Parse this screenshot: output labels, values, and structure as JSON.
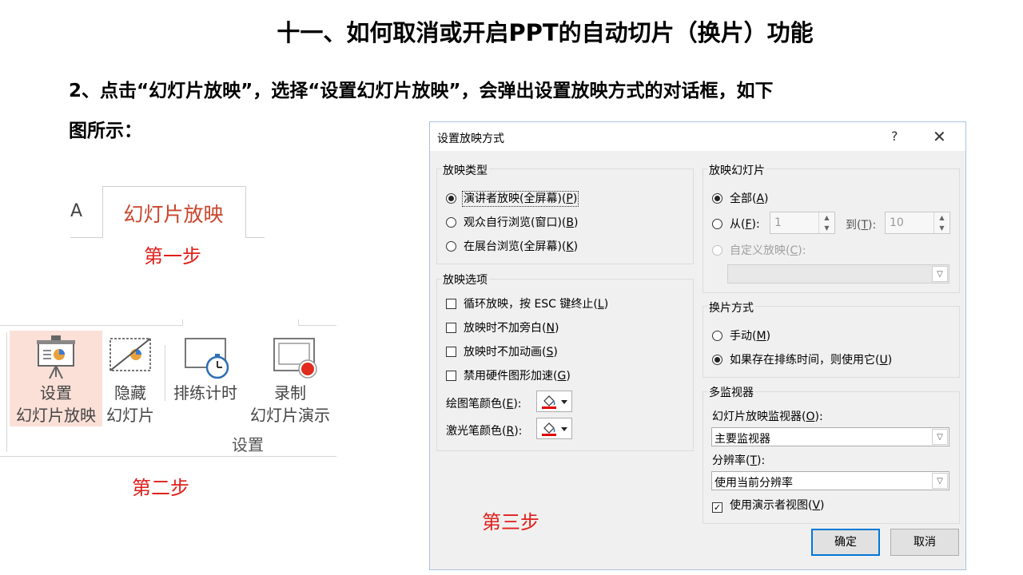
{
  "slide": {
    "title": "十一、如何取消或开启PPT的自动切片（换片）功能",
    "paragraph_line1": "2、点击“幻灯片放映”，选择“设置幻灯片放映”，会弹出设置放映方式的对话框，如下",
    "paragraph_line2": "图所示：",
    "step1": "第一步",
    "step2": "第二步",
    "step3": "第三步"
  },
  "ribbon": {
    "prev_tab_fragment": "A",
    "active_tab": "幻灯片放映",
    "buttons": [
      {
        "line1": "设置",
        "line2": "幻灯片放映"
      },
      {
        "line1": "隐藏",
        "line2": "幻灯片"
      },
      {
        "line1": "排练计时",
        "line2": ""
      },
      {
        "line1": "录制",
        "line2": "幻灯片演示"
      }
    ],
    "group_label": "设置"
  },
  "dialog": {
    "title": "设置放映方式",
    "help": "?",
    "close": "✕",
    "show_type": {
      "label": "放映类型",
      "options": [
        {
          "text": "演讲者放映(全屏幕)(",
          "key": "P",
          "selected": true
        },
        {
          "text": "观众自行浏览(窗口)(",
          "key": "B",
          "selected": false
        },
        {
          "text": "在展台浏览(全屏幕)(",
          "key": "K",
          "selected": false
        }
      ]
    },
    "show_options": {
      "label": "放映选项",
      "checks": [
        {
          "text": "循环放映，按 ESC 键终止(",
          "key": "L",
          "checked": false
        },
        {
          "text": "放映时不加旁白(",
          "key": "N",
          "checked": false
        },
        {
          "text": "放映时不加动画(",
          "key": "S",
          "checked": false
        },
        {
          "text": "禁用硬件图形加速(",
          "key": "G",
          "checked": false
        }
      ],
      "pen_color_label": "绘图笔颜色(",
      "pen_color_key": "E",
      "laser_color_label": "激光笔颜色(",
      "laser_color_key": "R",
      "pen_color": "#e00000",
      "laser_color": "#e00000"
    },
    "show_slides": {
      "label": "放映幻灯片",
      "all_text": "全部(",
      "all_key": "A",
      "from_text": "从(",
      "from_key": "F",
      "from_value": "1",
      "to_text": "到(",
      "to_key": "T",
      "to_value": "10",
      "custom_text": "自定义放映(",
      "custom_key": "C",
      "selected": "all"
    },
    "advance": {
      "label": "换片方式",
      "manual_text": "手动(",
      "manual_key": "M",
      "timings_text": "如果存在排练时间，则使用它(",
      "timings_key": "U",
      "selected": "timings"
    },
    "monitors": {
      "label": "多监视器",
      "monitor_label": "幻灯片放映监视器(",
      "monitor_key": "O",
      "monitor_value": "主要监视器",
      "resolution_label": "分辨率(",
      "resolution_key": "T",
      "resolution_value": "使用当前分辨率",
      "presenter_view_text": "使用演示者视图(",
      "presenter_view_key": "V",
      "presenter_view_checked": true
    },
    "ok": "确定",
    "cancel": "取消"
  }
}
